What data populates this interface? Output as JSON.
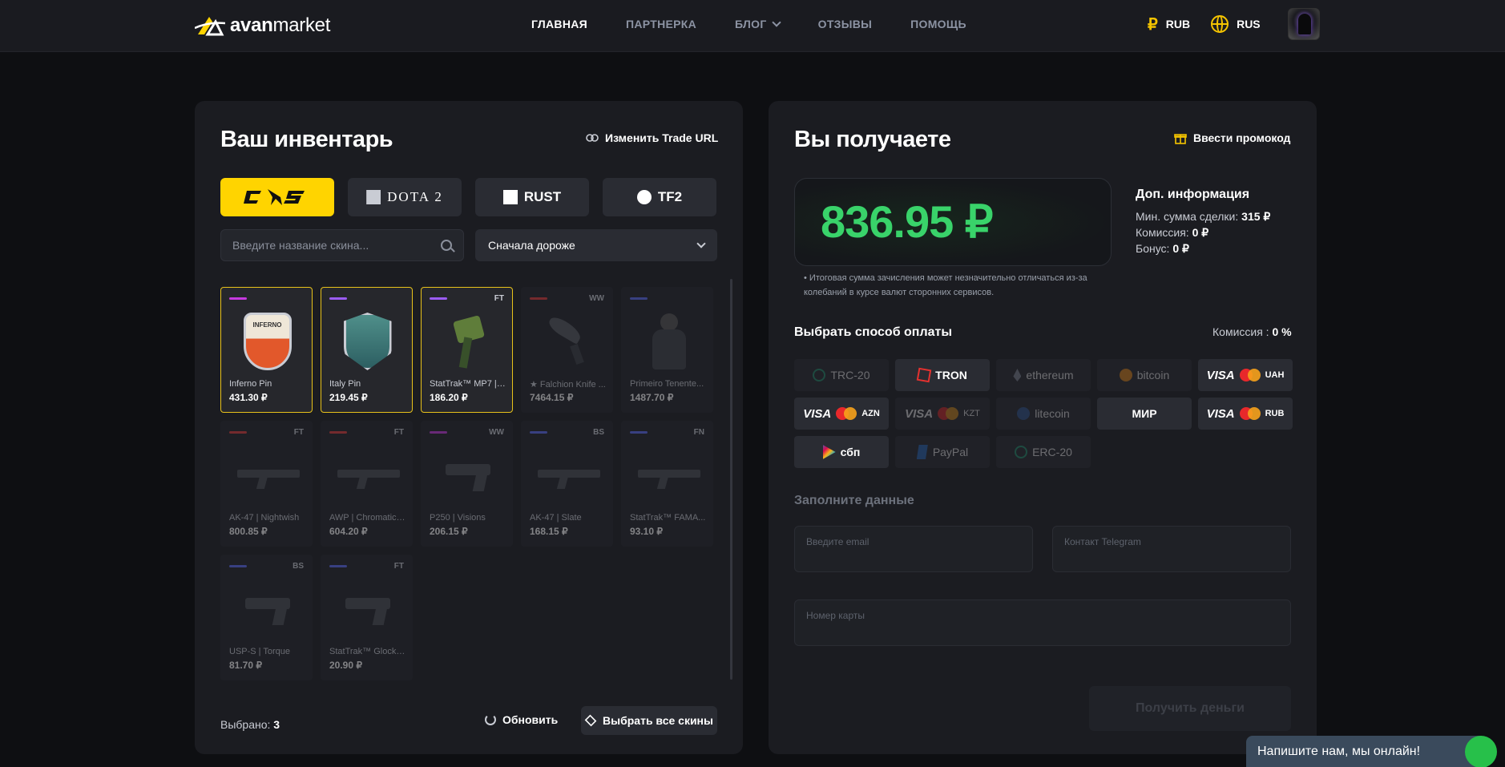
{
  "header": {
    "logo_text_bold": "avan",
    "logo_text": "market",
    "nav": [
      {
        "label": "ГЛАВНАЯ",
        "active": true
      },
      {
        "label": "ПАРТНЕРКА",
        "active": false
      },
      {
        "label": "БЛОГ",
        "active": false,
        "dropdown": true
      },
      {
        "label": "ОТЗЫВЫ",
        "active": false
      },
      {
        "label": "ПОМОЩЬ",
        "active": false
      }
    ],
    "currency": "RUB",
    "currency_icon": "₽",
    "language": "RUS"
  },
  "inventory": {
    "title": "Ваш инвентарь",
    "trade_url_label": "Изменить Trade URL",
    "tabs": [
      {
        "label": "CS",
        "active": true
      },
      {
        "label": "DOTA 2",
        "active": false
      },
      {
        "label": "RUST",
        "active": false
      },
      {
        "label": "TF2",
        "active": false
      }
    ],
    "search_placeholder": "Введите название скина...",
    "sort_value": "Сначала дороже",
    "items": [
      {
        "name": "Inferno Pin",
        "price": "431.30 ₽",
        "wear": "",
        "rarity_color": "#c73adf",
        "selected": true,
        "dim": false,
        "pic": "pin-inferno",
        "pin_text": "INFERNO"
      },
      {
        "name": "Italy Pin",
        "price": "219.45 ₽",
        "wear": "",
        "rarity_color": "#9b5cf5",
        "selected": true,
        "dim": false,
        "pic": "pin-italy",
        "pin_text": ""
      },
      {
        "name": "StatTrak™ MP7 | ...",
        "price": "186.20 ₽",
        "wear": "FT",
        "rarity_color": "#9b5cf5",
        "selected": true,
        "dim": false,
        "pic": "mp7",
        "pin_text": ""
      },
      {
        "name": "★ Falchion Knife ...",
        "price": "7464.15 ₽",
        "wear": "WW",
        "rarity_color": "#e03c3c",
        "selected": false,
        "dim": true,
        "pic": "knife",
        "pin_text": ""
      },
      {
        "name": "Primeiro Tenente...",
        "price": "1487.70 ₽",
        "wear": "",
        "rarity_color": "#5b6cf5",
        "selected": false,
        "dim": true,
        "pic": "agent",
        "pin_text": ""
      },
      {
        "name": "AK-47 | Nightwish",
        "price": "800.85 ₽",
        "wear": "FT",
        "rarity_color": "#e03c3c",
        "selected": false,
        "dim": true,
        "pic": "gun",
        "pin_text": ""
      },
      {
        "name": "AWP | Chromatic ...",
        "price": "604.20 ₽",
        "wear": "FT",
        "rarity_color": "#e03c3c",
        "selected": false,
        "dim": true,
        "pic": "gun",
        "pin_text": ""
      },
      {
        "name": "P250 | Visions",
        "price": "206.15 ₽",
        "wear": "WW",
        "rarity_color": "#c73adf",
        "selected": false,
        "dim": true,
        "pic": "pistol",
        "pin_text": ""
      },
      {
        "name": "AK-47 | Slate",
        "price": "168.15 ₽",
        "wear": "BS",
        "rarity_color": "#5b6cf5",
        "selected": false,
        "dim": true,
        "pic": "gun",
        "pin_text": ""
      },
      {
        "name": "StatTrak™ FAMA...",
        "price": "93.10 ₽",
        "wear": "FN",
        "rarity_color": "#5b6cf5",
        "selected": false,
        "dim": true,
        "pic": "gun",
        "pin_text": ""
      },
      {
        "name": "USP-S | Torque",
        "price": "81.70 ₽",
        "wear": "BS",
        "rarity_color": "#5b6cf5",
        "selected": false,
        "dim": true,
        "pic": "pistol",
        "pin_text": ""
      },
      {
        "name": "StatTrak™ Glock-...",
        "price": "20.90 ₽",
        "wear": "FT",
        "rarity_color": "#5b6cf5",
        "selected": false,
        "dim": true,
        "pic": "pistol",
        "pin_text": ""
      }
    ],
    "selected_label": "Выбрано:",
    "selected_count": "3",
    "refresh_label": "Обновить",
    "select_all_label": "Выбрать все скины"
  },
  "receive": {
    "title": "Вы получаете",
    "promo_label": "Ввести промокод",
    "amount": "836.95 ₽",
    "note": "• Итоговая сумма зачисления может незначительно отличаться из-за колебаний в курсе валют сторонних сервисов.",
    "info_title": "Доп. информация",
    "min_label": "Мин. сумма сделки:",
    "min_value": "315 ₽",
    "commission_label": "Комиссия:",
    "commission_value": "0 ₽",
    "bonus_label": "Бонус:",
    "bonus_value": "0 ₽",
    "payment_title": "Выбрать способ оплаты",
    "payment_commission_label": "Комиссия :",
    "payment_commission_value": "0 %",
    "payments": [
      {
        "label": "TRC-20",
        "icon": "tether",
        "dim": true
      },
      {
        "label": "TRON",
        "icon": "tron",
        "dim": false
      },
      {
        "label": "ethereum",
        "icon": "eth",
        "dim": true
      },
      {
        "label": "bitcoin",
        "icon": "btc",
        "dim": true
      },
      {
        "label": "VISA",
        "suffix": "UAH",
        "icon": "mc",
        "dim": false
      },
      {
        "label": "VISA",
        "suffix": "AZN",
        "icon": "mc",
        "dim": false
      },
      {
        "label": "VISA",
        "suffix": "KZT",
        "icon": "mc",
        "dim": true
      },
      {
        "label": "litecoin",
        "icon": "ltc",
        "dim": true
      },
      {
        "label": "МИР",
        "icon": "",
        "dim": false
      },
      {
        "label": "VISA",
        "suffix": "RUB",
        "icon": "mc",
        "dim": false
      },
      {
        "label": "сбп",
        "icon": "sbp",
        "dim": false
      },
      {
        "label": "PayPal",
        "icon": "pp",
        "dim": true
      },
      {
        "label": "ERC-20",
        "icon": "tether",
        "dim": true
      }
    ],
    "fill_title": "Заполните данные",
    "email_placeholder": "Введите email",
    "telegram_placeholder": "Контакт Telegram",
    "card_placeholder": "Номер карты",
    "submit_label": "Получить деньги"
  },
  "chat": {
    "label": "Напишите нам, мы онлайн!"
  }
}
